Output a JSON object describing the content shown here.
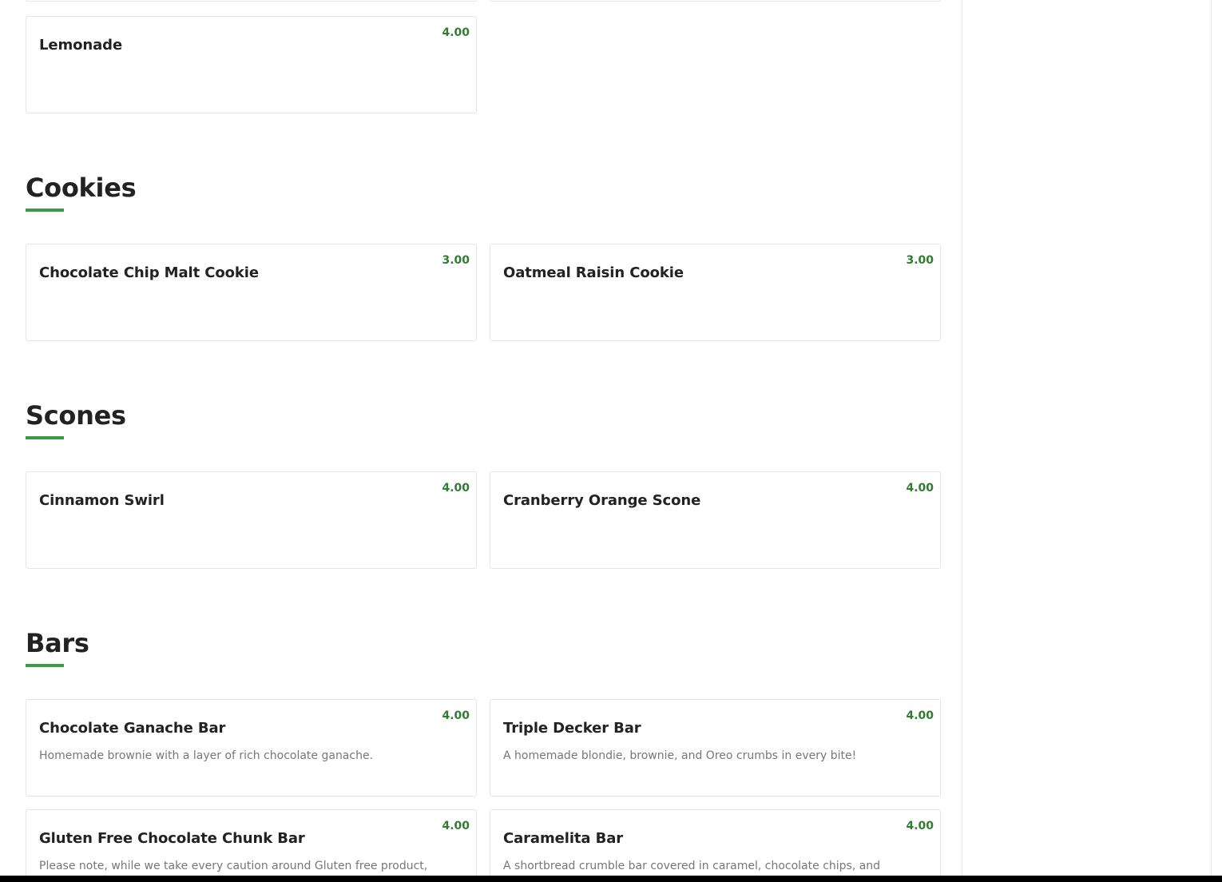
{
  "colors": {
    "accent": "#3a9a46",
    "price": "#2e7d32",
    "text": "#222222",
    "description": "#777777",
    "border": "#e5e5e5"
  },
  "sections": [
    {
      "title": "",
      "items": [
        {
          "name": "Lemonade",
          "price": "4.00",
          "description": ""
        }
      ]
    },
    {
      "title": "Cookies",
      "items": [
        {
          "name": "Chocolate Chip Malt Cookie",
          "price": "3.00",
          "description": ""
        },
        {
          "name": "Oatmeal Raisin Cookie",
          "price": "3.00",
          "description": ""
        }
      ]
    },
    {
      "title": "Scones",
      "items": [
        {
          "name": "Cinnamon Swirl",
          "price": "4.00",
          "description": ""
        },
        {
          "name": "Cranberry Orange Scone",
          "price": "4.00",
          "description": ""
        }
      ]
    },
    {
      "title": "Bars",
      "items": [
        {
          "name": "Chocolate Ganache Bar",
          "price": "4.00",
          "description": "Homemade brownie with a layer of rich chocolate ganache."
        },
        {
          "name": "Triple Decker Bar",
          "price": "4.00",
          "description": "A homemade blondie, brownie, and Oreo crumbs in every bite!"
        },
        {
          "name": "Gluten Free Chocolate Chunk Bar",
          "price": "4.00",
          "description": "Please note, while we take every caution around Gluten free product, there is always a risk of cross contamination."
        },
        {
          "name": "Caramelita Bar",
          "price": "4.00",
          "description": "A shortbread crumble bar covered in caramel, chocolate chips, and topped with more crumble."
        }
      ]
    }
  ]
}
